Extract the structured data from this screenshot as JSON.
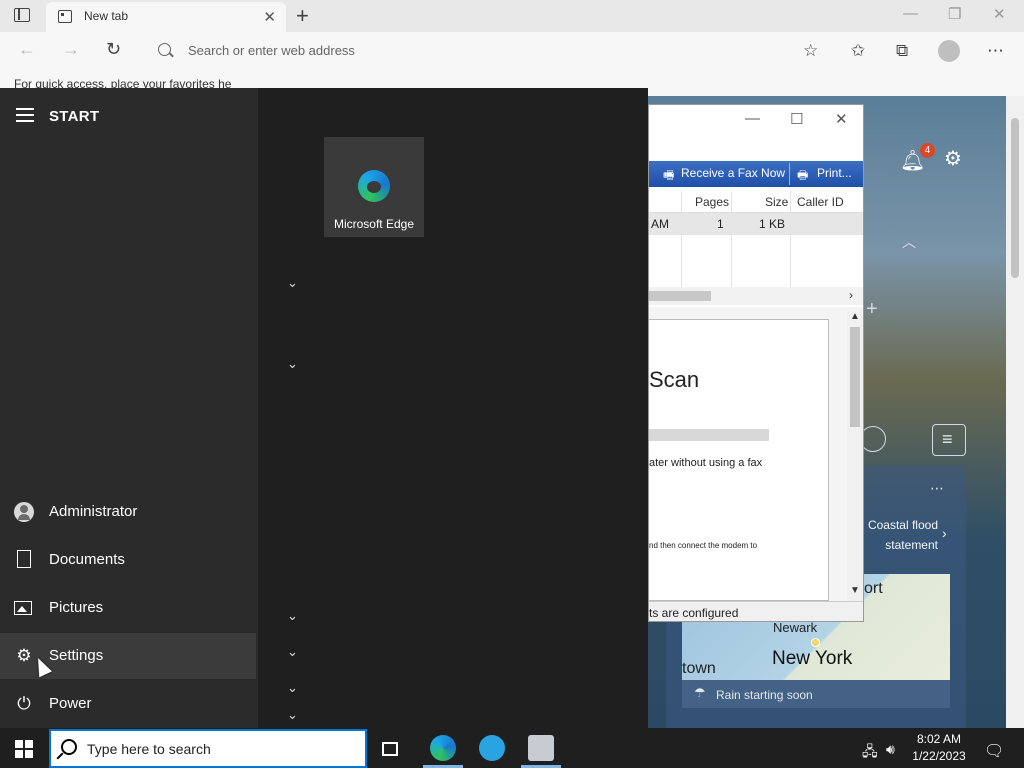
{
  "browser": {
    "tab_title": "New tab",
    "address_placeholder": "Search or enter web address",
    "favorites_hint": "For quick access, place your favorites he"
  },
  "ntp": {
    "notification_count": "4",
    "weather_alert": "Coastal flood statement",
    "map_labels": {
      "newark": "Newark",
      "new_york": "New York",
      "town": "town",
      "port": "ort"
    },
    "rain": "Rain starting soon"
  },
  "fax": {
    "toolbar": {
      "receive": "Receive a Fax Now",
      "print": "Print..."
    },
    "columns": {
      "pages": "Pages",
      "size": "Size",
      "caller_id": "Caller ID"
    },
    "row": {
      "time": "AM",
      "pages": "1",
      "size": "1 KB",
      "caller_id": ""
    },
    "preview_heading": "Scan",
    "preview_text1": "ater without using a fax",
    "preview_text2": "nd then connect the modem to",
    "status": "ts are configured"
  },
  "start": {
    "title": "START",
    "items": [
      {
        "label": "Administrator",
        "icon": "user-icon"
      },
      {
        "label": "Documents",
        "icon": "document-icon"
      },
      {
        "label": "Pictures",
        "icon": "pictures-icon"
      },
      {
        "label": "Settings",
        "icon": "gear-icon"
      },
      {
        "label": "Power",
        "icon": "power-icon"
      }
    ],
    "tile": {
      "label": "Microsoft Edge"
    }
  },
  "taskbar": {
    "search_placeholder": "Type here to search",
    "time": "8:02 AM",
    "date": "1/22/2023"
  }
}
